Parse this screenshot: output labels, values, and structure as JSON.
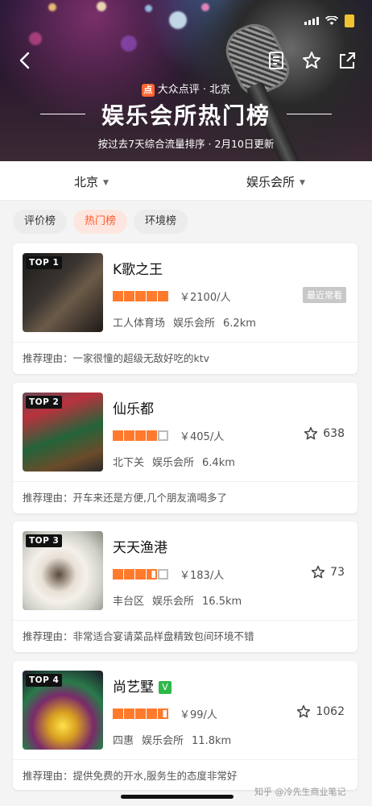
{
  "header": {
    "brand": "大众点评",
    "city": "北京",
    "separator": "·",
    "title": "娱乐会所热门榜",
    "subtitle": "按过去7天综合流量排序 · 2月10日更新",
    "brand_color": "#ff6633"
  },
  "filters": {
    "city": "北京",
    "category": "娱乐会所"
  },
  "tabs": [
    {
      "label": "评价榜",
      "active": false
    },
    {
      "label": "热门榜",
      "active": true
    },
    {
      "label": "环境榜",
      "active": false
    }
  ],
  "reason_prefix": "推荐理由：",
  "items": [
    {
      "rank": "TOP 1",
      "name": "K歌之王",
      "stars": 5,
      "price": "￥2100/人",
      "area": "工人体育场",
      "category": "娱乐会所",
      "distance": "6.2km",
      "badge": "最近常看",
      "reason": "一家很憧的超级无敌好吃的ktv"
    },
    {
      "rank": "TOP 2",
      "name": "仙乐都",
      "stars": 4,
      "price": "￥405/人",
      "area": "北下关",
      "category": "娱乐会所",
      "distance": "6.4km",
      "favorites": "638",
      "reason": "开车来还是方便,几个朋友滴喝多了"
    },
    {
      "rank": "TOP 3",
      "name": "天天渔港",
      "stars": 3.5,
      "price": "￥183/人",
      "area": "丰台区",
      "category": "娱乐会所",
      "distance": "16.5km",
      "favorites": "73",
      "reason": "非常适合宴请菜品样盘精致包间环境不错"
    },
    {
      "rank": "TOP 4",
      "name": "尚艺墅",
      "vip": "V",
      "stars": 4.5,
      "price": "￥99/人",
      "area": "四惠",
      "category": "娱乐会所",
      "distance": "11.8km",
      "favorites": "1062",
      "reason": "提供免费的开水,服务生的态度非常好"
    }
  ],
  "watermark": "知乎 @冷先生商业笔记"
}
